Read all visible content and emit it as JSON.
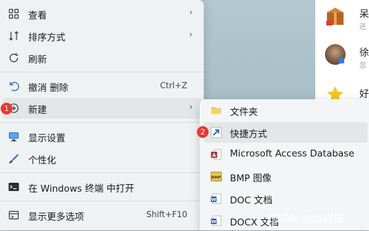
{
  "menu": {
    "items": [
      {
        "label": "查看",
        "icon": "grid-icon"
      },
      {
        "label": "排序方式",
        "icon": "sort-icon"
      },
      {
        "label": "刷新",
        "icon": "refresh-icon"
      },
      {
        "label": "撤消 删除",
        "icon": "undo-icon",
        "shortcut": "Ctrl+Z"
      },
      {
        "label": "新建",
        "icon": "new-icon"
      },
      {
        "label": "显示设置",
        "icon": "display-icon"
      },
      {
        "label": "个性化",
        "icon": "brush-icon"
      },
      {
        "label": "在 Windows 终端 中打开",
        "icon": "terminal-icon"
      },
      {
        "label": "显示更多选项",
        "icon": "more-options-icon",
        "shortcut": "Shift+F10"
      }
    ]
  },
  "submenu": {
    "items": [
      {
        "label": "文件夹",
        "icon": "folder-icon"
      },
      {
        "label": "快捷方式",
        "icon": "shortcut-icon"
      },
      {
        "label": "Microsoft Access Database",
        "icon": "access-icon"
      },
      {
        "label": "BMP 图像",
        "icon": "bmp-icon"
      },
      {
        "label": "DOC 文档",
        "icon": "doc-icon"
      },
      {
        "label": "DOCX 文档",
        "icon": "docx-icon"
      }
    ]
  },
  "badges": {
    "new": "1",
    "shortcut": "2"
  },
  "chat": {
    "items": [
      {
        "name": "呆",
        "sub": "还"
      },
      {
        "name": "徐",
        "sub": "忽"
      },
      {
        "name": "好",
        "sub": ""
      }
    ]
  },
  "watermark": "CSDN @俎树振",
  "colors": {
    "badge": "#e53935",
    "folder": "#f2c14e",
    "access": "#a4373a",
    "doc": "#2b579a"
  }
}
